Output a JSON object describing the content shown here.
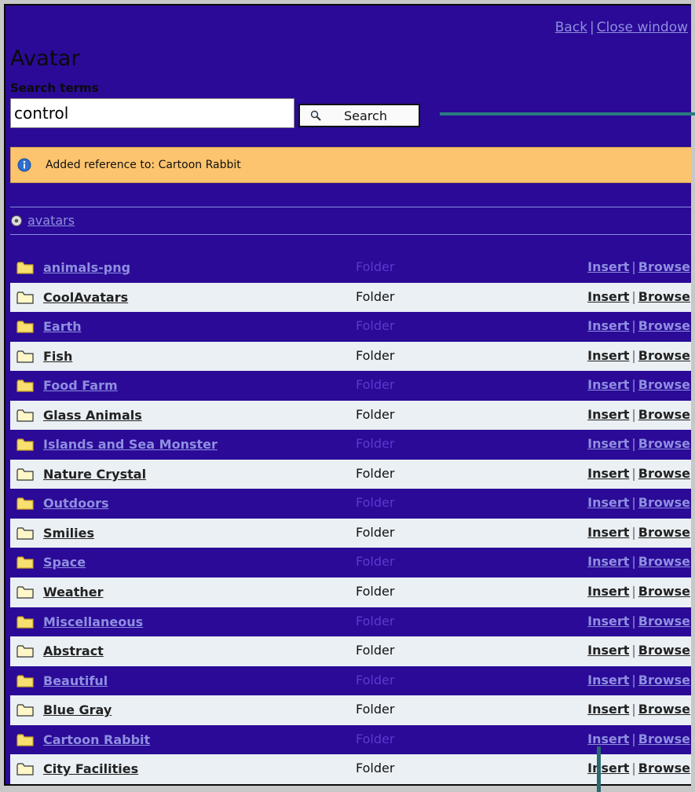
{
  "header": {
    "back_label": "Back",
    "separator": "|",
    "close_label": "Close window",
    "title": "Avatar"
  },
  "search": {
    "label": "Search terms",
    "value": "control",
    "button_label": "Search"
  },
  "notice": {
    "text": "Added reference to: Cartoon Rabbit"
  },
  "breadcrumb": {
    "label": "avatars"
  },
  "actions": {
    "insert": "Insert",
    "separator": "|",
    "browse": "Browse"
  },
  "folders": [
    {
      "name": "animals-png",
      "type": "Folder"
    },
    {
      "name": "CoolAvatars",
      "type": "Folder"
    },
    {
      "name": "Earth",
      "type": "Folder"
    },
    {
      "name": "Fish",
      "type": "Folder"
    },
    {
      "name": "Food Farm",
      "type": "Folder"
    },
    {
      "name": "Glass Animals",
      "type": "Folder"
    },
    {
      "name": "Islands and Sea Monster",
      "type": "Folder"
    },
    {
      "name": "Nature Crystal",
      "type": "Folder"
    },
    {
      "name": "Outdoors",
      "type": "Folder"
    },
    {
      "name": "Smilies",
      "type": "Folder"
    },
    {
      "name": "Space",
      "type": "Folder"
    },
    {
      "name": "Weather",
      "type": "Folder"
    },
    {
      "name": "Miscellaneous",
      "type": "Folder"
    },
    {
      "name": "Abstract",
      "type": "Folder"
    },
    {
      "name": "Beautiful",
      "type": "Folder"
    },
    {
      "name": "Blue Gray",
      "type": "Folder"
    },
    {
      "name": "Cartoon Rabbit",
      "type": "Folder"
    },
    {
      "name": "City Facilities",
      "type": "Folder"
    }
  ],
  "icons": {
    "search_button": "magnifier-icon",
    "notice": "info-icon",
    "breadcrumb": "gear-icon",
    "row": "folder-icon"
  },
  "colors": {
    "background": "#2a0a96",
    "row_light": "#eaf0f4",
    "notice_bg": "#fcc46e",
    "link_light": "#8f8fe0"
  }
}
